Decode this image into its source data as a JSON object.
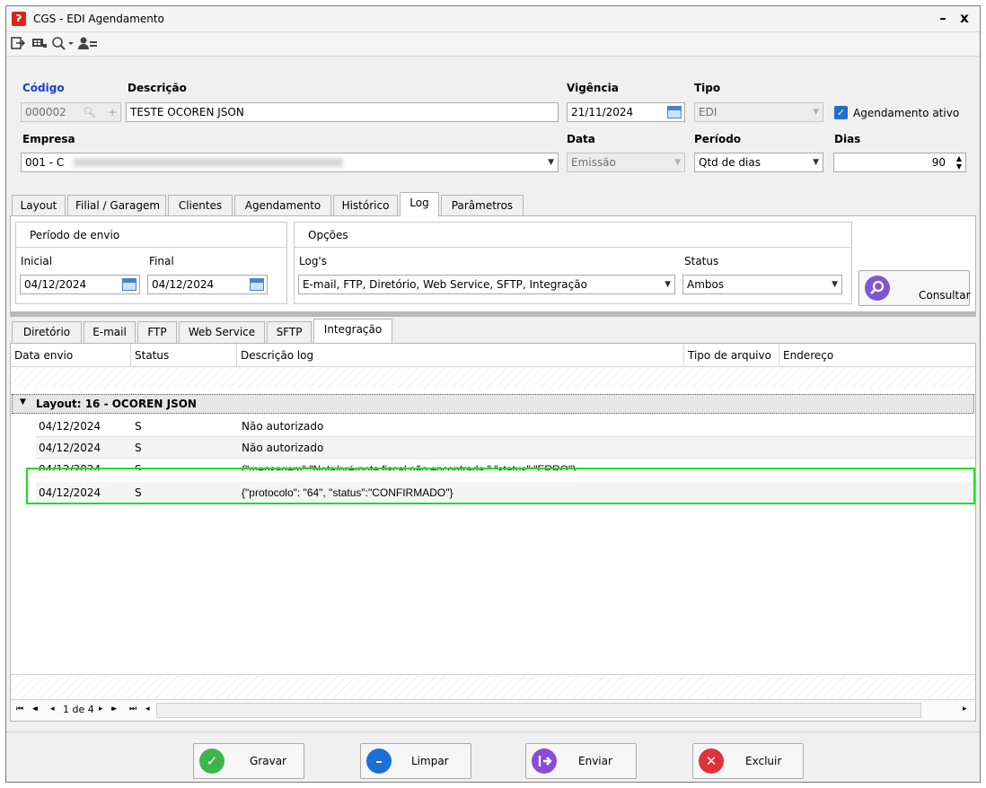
{
  "window": {
    "title": "CGS - EDI Agendamento",
    "minimize": "–",
    "close": "x"
  },
  "toolbar": {
    "icons": [
      "exit-icon",
      "grid-icon",
      "search-icon",
      "users-icon"
    ]
  },
  "form": {
    "codigo": {
      "label": "Código",
      "value": "000002"
    },
    "descricao": {
      "label": "Descrição",
      "value": "TESTE OCOREN JSON"
    },
    "vigencia": {
      "label": "Vigência",
      "value": "21/11/2024"
    },
    "tipo": {
      "label": "Tipo",
      "value": "EDI"
    },
    "agendamento_ativo": {
      "label": "Agendamento ativo",
      "checked": true
    },
    "empresa": {
      "label": "Empresa",
      "value": "001 - C"
    },
    "data": {
      "label": "Data",
      "value": "Emissão"
    },
    "periodo": {
      "label": "Período",
      "value": "Qtd de dias"
    },
    "dias": {
      "label": "Dias",
      "value": "90"
    }
  },
  "tabs": [
    "Layout",
    "Filial / Garagem",
    "Clientes",
    "Agendamento",
    "Histórico",
    "Log",
    "Parâmetros"
  ],
  "active_tab": "Log",
  "log": {
    "periodo_envio": {
      "title": "Período de envio",
      "inicial_label": "Inicial",
      "inicial_value": "04/12/2024",
      "final_label": "Final",
      "final_value": "04/12/2024"
    },
    "opcoes": {
      "title": "Opções",
      "logs_label": "Log's",
      "logs_value": "E-mail, FTP, Diretório, Web Service, SFTP, Integração",
      "status_label": "Status",
      "status_value": "Ambos"
    },
    "consultar_label": "Consultar"
  },
  "subtabs": [
    "Diretório",
    "E-mail",
    "FTP",
    "Web Service",
    "SFTP",
    "Integração"
  ],
  "active_subtab": "Integração",
  "grid": {
    "columns": [
      "Data envio",
      "Status",
      "Descrição log",
      "Tipo de arquivo",
      "Endereço"
    ],
    "group_label": "Layout: 16 - OCOREN JSON",
    "rows": [
      {
        "date": "04/12/2024",
        "status": "S",
        "desc": "Não autorizado"
      },
      {
        "date": "04/12/2024",
        "status": "S",
        "desc": "Não autorizado"
      },
      {
        "date": "04/12/2024",
        "status": "S",
        "desc": "{\"mensagem\":\"Nota/pré-nota fiscal não encontrada.\",\"status\":\"ERRO\"}"
      },
      {
        "date": "04/12/2024",
        "status": "S",
        "desc": "{\"protocolo\": \"64\", \"status\":\"CONFIRMADO\"}"
      }
    ],
    "pager": {
      "first": "⏮",
      "prev_page": "◂◂",
      "prev": "◂",
      "page_text": "1 de 4",
      "next": "▸",
      "next_page": "▸▸",
      "last": "⏭",
      "scroll_left": "◂",
      "scroll_right": "▸"
    }
  },
  "buttons": {
    "gravar": "Gravar",
    "limpar": "Limpar",
    "enviar": "Enviar",
    "excluir": "Excluir"
  },
  "colors": {
    "highlight": "#22dd22",
    "label_blue": "#1a3ed6",
    "gravar": "#3cb54a",
    "limpar": "#1b6fd6",
    "enviar": "#8a4bd6",
    "excluir": "#e0303a"
  }
}
